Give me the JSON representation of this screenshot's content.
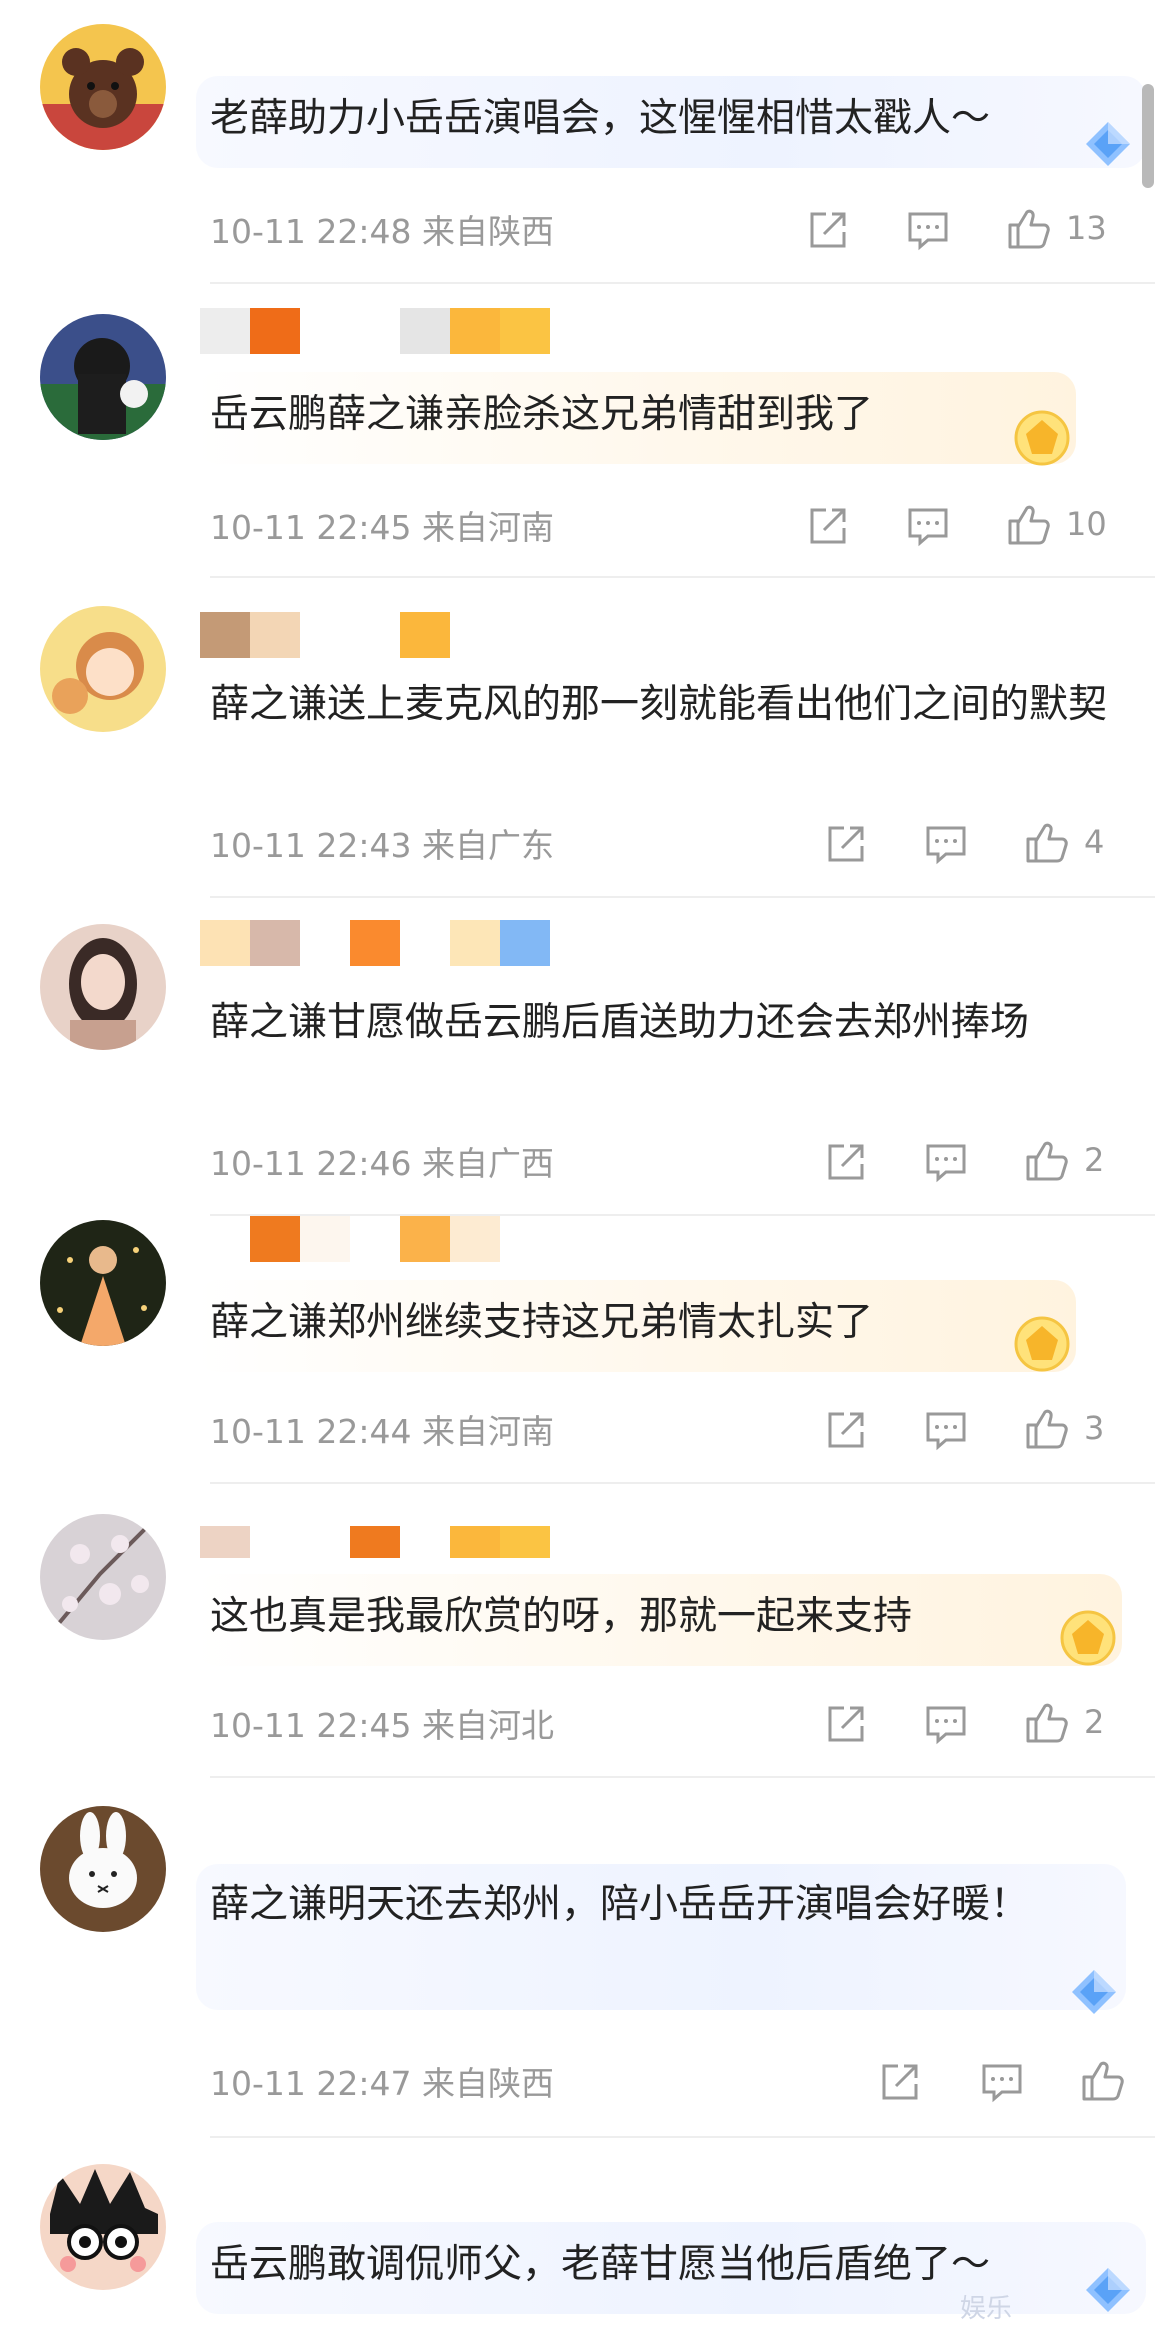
{
  "comments": [
    {
      "text": "老薛助力小岳岳演唱会，这惺惺相惜太戳人～",
      "time": "10-11 22:48",
      "location": "来自陕西",
      "likes": "13",
      "badge": "diamond-icon"
    },
    {
      "text": "岳云鹏薛之谦亲脸杀这兄弟情甜到我了",
      "time": "10-11 22:45",
      "location": "来自河南",
      "likes": "10",
      "badge": "gold-medal-icon"
    },
    {
      "text": "薛之谦送上麦克风的那一刻就能看出他们之间的默契",
      "time": "10-11 22:43",
      "location": "来自广东",
      "likes": "4",
      "badge": ""
    },
    {
      "text": "薛之谦甘愿做岳云鹏后盾送助力还会去郑州捧场",
      "time": "10-11 22:46",
      "location": "来自广西",
      "likes": "2",
      "badge": ""
    },
    {
      "text": "薛之谦郑州继续支持这兄弟情太扎实了",
      "time": "10-11 22:44",
      "location": "来自河南",
      "likes": "3",
      "badge": "gold-medal-icon"
    },
    {
      "text": "这也真是我最欣赏的呀，那就一起来支持",
      "time": "10-11 22:45",
      "location": "来自河北",
      "likes": "2",
      "badge": "gold-medal-icon"
    },
    {
      "text": "薛之谦明天还去郑州，陪小岳岳开演唱会好暖！",
      "time": "10-11 22:47",
      "location": "来自陕西",
      "likes": "",
      "badge": "diamond-icon"
    },
    {
      "text": "岳云鹏敢调侃师父，老薛甘愿当他后盾绝了～",
      "time": "",
      "location": "",
      "likes": "",
      "badge": "diamond-icon"
    }
  ],
  "icons": {
    "share": "share-icon",
    "reply": "comment-icon",
    "like": "thumbs-up-icon"
  },
  "watermark": "娱乐"
}
